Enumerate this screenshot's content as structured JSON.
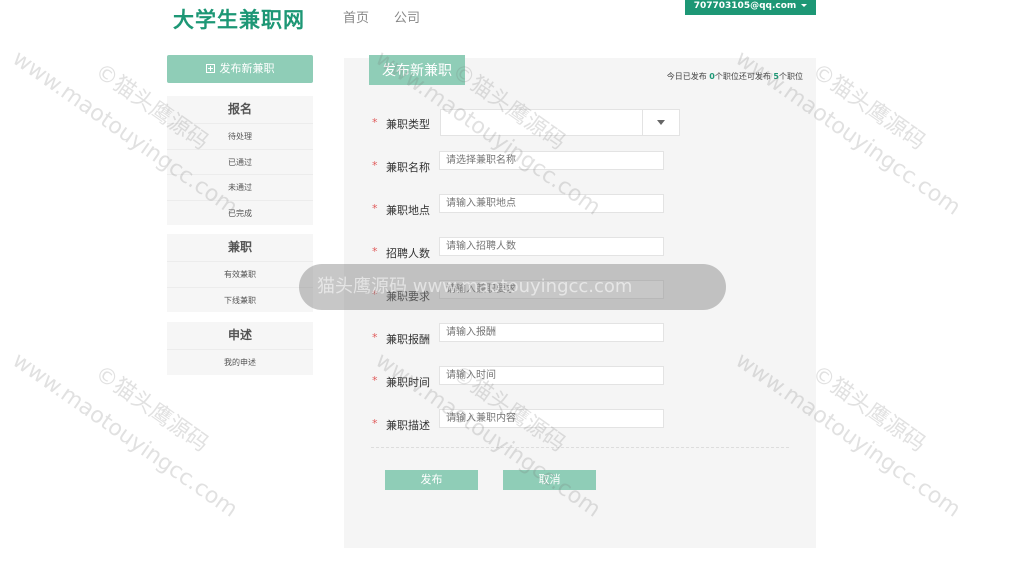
{
  "header": {
    "logo": "大学生兼职网",
    "nav": {
      "home": "首页",
      "company": "公司"
    },
    "user_email": "707703105@qq.com"
  },
  "sidebar": {
    "publish_button": "发布新兼职",
    "groups": [
      {
        "title": "报名",
        "items": [
          "待处理",
          "已通过",
          "未通过",
          "已完成"
        ]
      },
      {
        "title": "兼职",
        "items": [
          "有效兼职",
          "下线兼职"
        ]
      },
      {
        "title": "申述",
        "items": [
          "我的申述"
        ]
      }
    ]
  },
  "main": {
    "title": "发布新兼职",
    "quota": {
      "prefix": "今日已发布",
      "published": "0",
      "middle": "个职位还可发布",
      "remaining": "5",
      "suffix": "个职位"
    },
    "form": {
      "required_mark": "*",
      "type_label": "兼职类型",
      "name_label": "兼职名称",
      "name_placeholder": "请选择兼职名称",
      "location_label": "兼职地点",
      "location_placeholder": "请输入兼职地点",
      "count_label": "招聘人数",
      "count_placeholder": "请输入招聘人数",
      "requirement_label": "兼职要求",
      "requirement_placeholder": "请输入兼职要求",
      "salary_label": "兼职报酬",
      "salary_placeholder": "请输入报酬",
      "time_label": "兼职时间",
      "time_placeholder": "请输入时间",
      "desc_label": "兼职描述",
      "desc_placeholder": "请输入兼职内容"
    },
    "buttons": {
      "submit": "发布",
      "cancel": "取消"
    }
  },
  "watermark": {
    "text": "www.maotouyingcc.com",
    "brand": "©猫头鹰源码",
    "toast": "猫头鹰源码  www.maotouyingcc.com"
  },
  "colors": {
    "brand": "#1d9775",
    "accent_light": "#8fcdb7",
    "required": "#e05a5a"
  }
}
